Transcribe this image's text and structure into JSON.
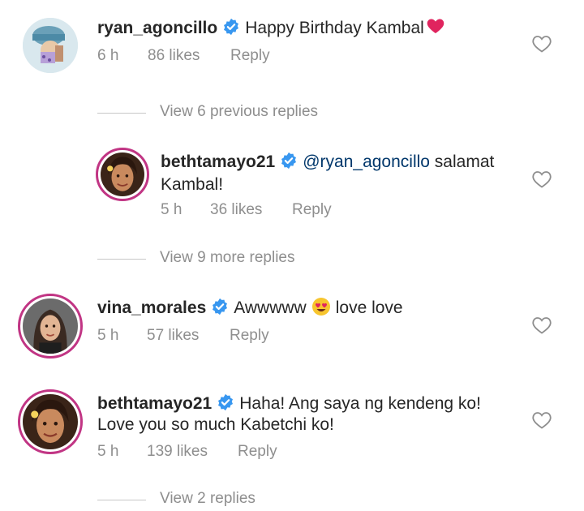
{
  "comments": [
    {
      "username": "ryan_agoncillo",
      "text": "Happy Birthday Kambal",
      "time": "6 h",
      "likes": "86 likes",
      "reply": "Reply"
    },
    {
      "username": "bethtamayo21",
      "mention": "@ryan_agoncillo",
      "text1": " salamat",
      "text2": "Kambal!",
      "time": "5 h",
      "likes": "36 likes",
      "reply": "Reply"
    },
    {
      "username": "vina_morales",
      "text1": "Awwwww",
      "text2": "love love",
      "time": "5 h",
      "likes": "57 likes",
      "reply": "Reply"
    },
    {
      "username": "bethtamayo21",
      "text1": "Haha! Ang saya ng kendeng ko!",
      "text2": "Love you so much Kabetchi ko!",
      "time": "5 h",
      "likes": "139 likes",
      "reply": "Reply"
    }
  ],
  "reply_links": [
    "View 6 previous replies",
    "View 9 more replies",
    "View 2 replies"
  ],
  "colors": {
    "verified": "#3897f0",
    "heart_red": "#e0245e",
    "secondary_text": "#8e8e8e",
    "mention": "#00376b",
    "story_ring": "#c13584"
  },
  "icons": [
    "verified-badge-icon",
    "heart-icon",
    "red-heart-emoji",
    "heart-eyes-emoji"
  ]
}
